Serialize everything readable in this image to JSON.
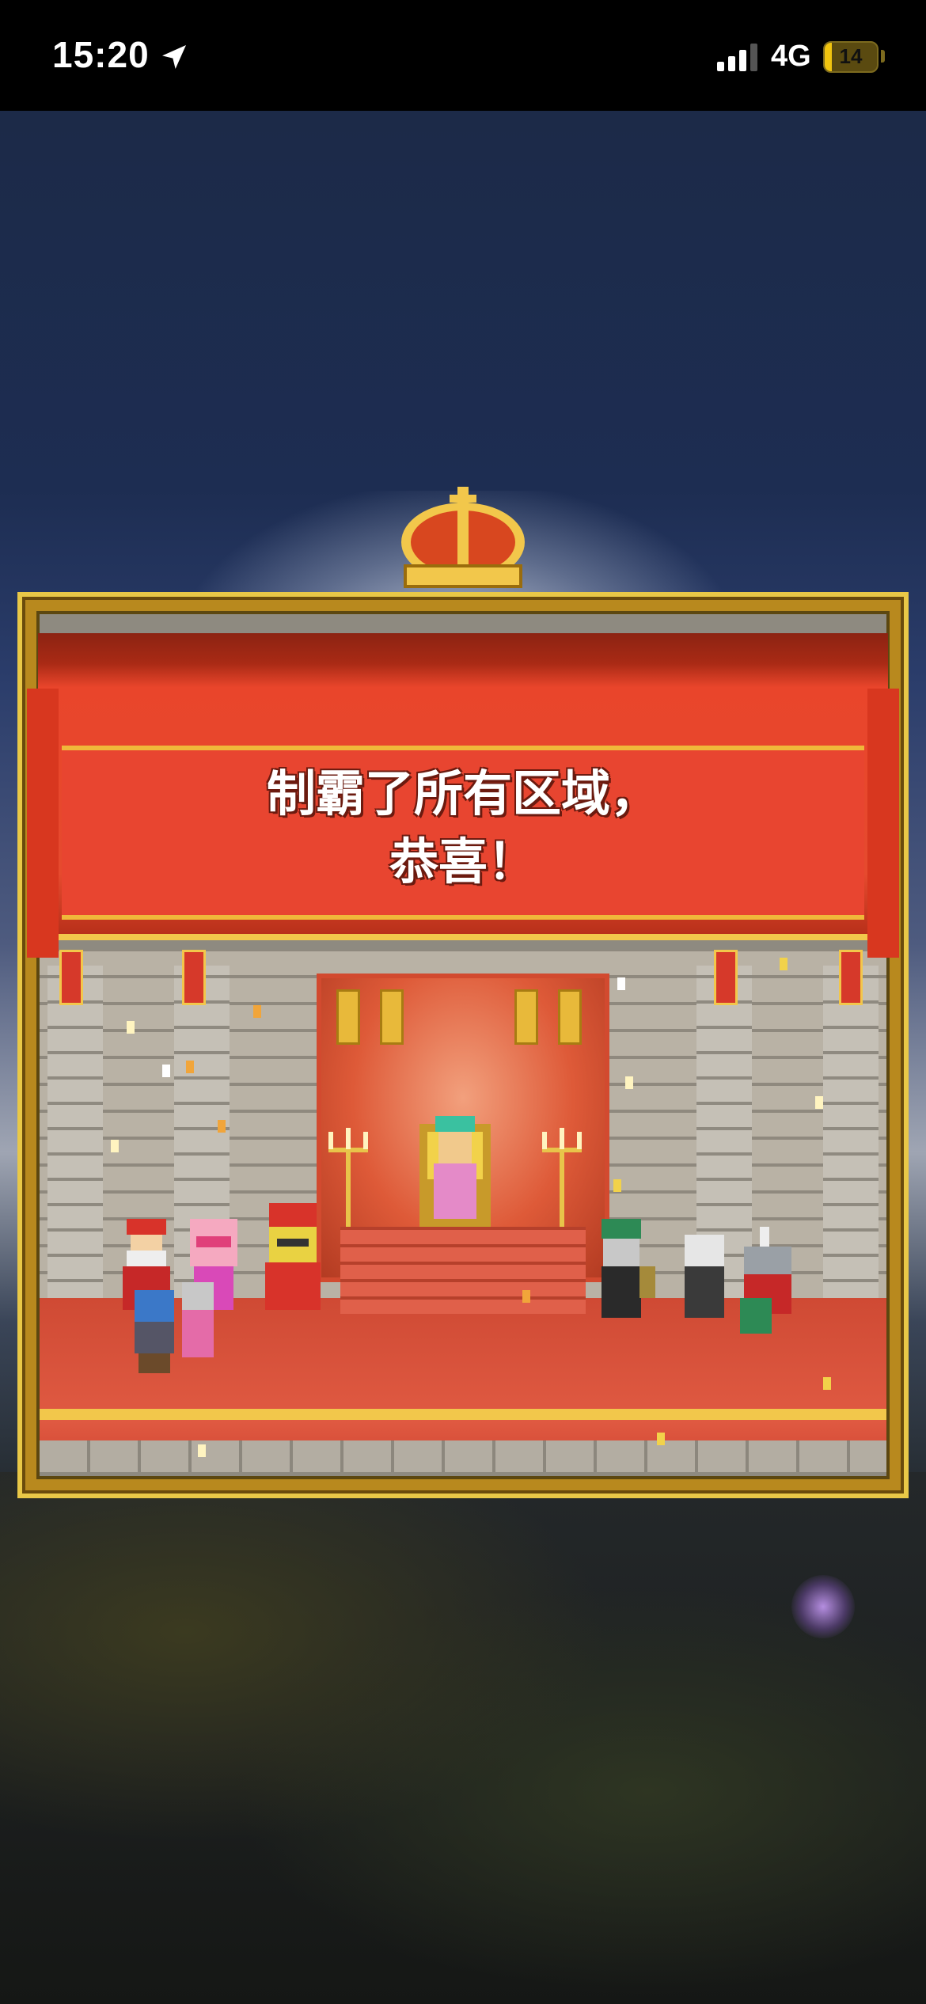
{
  "status_bar": {
    "time": "15:20",
    "network": "4G",
    "battery_level": "14",
    "icons": [
      "location-arrow-icon",
      "cellular-signal-icon",
      "battery-charging-icon"
    ]
  },
  "banner": {
    "line1": "制霸了所有区域，",
    "line2": "恭喜！"
  },
  "colors": {
    "banner_red": "#e84530",
    "gold_trim": "#f2c74b",
    "sky_blue": "#1d2d52"
  }
}
